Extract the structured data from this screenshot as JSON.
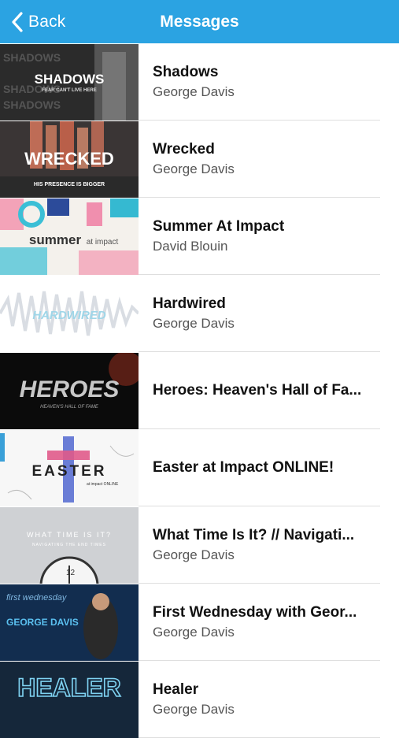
{
  "nav": {
    "back_label": "Back",
    "title": "Messages",
    "back_icon": "chevron-left-icon"
  },
  "messages": [
    {
      "title": "Shadows",
      "author": "George Davis",
      "thumb": {
        "text": "SHADOWS",
        "subtext": "FEAR CAN'T LIVE HERE"
      }
    },
    {
      "title": "Wrecked",
      "author": "George Davis",
      "thumb": {
        "text": "WRECKED",
        "subtext": "HIS PRESENCE IS BIGGER"
      }
    },
    {
      "title": "Summer At Impact",
      "author": "David Blouin",
      "thumb": {
        "text": "summer",
        "subtext": "at impact"
      }
    },
    {
      "title": "Hardwired",
      "author": "George Davis",
      "thumb": {
        "text": "HARDWIRED"
      }
    },
    {
      "title": "Heroes: Heaven's Hall of Fa...",
      "author": "",
      "thumb": {
        "text": "HEROES",
        "subtext": "HEAVEN'S HALL OF FAME"
      }
    },
    {
      "title": "Easter at Impact ONLINE!",
      "author": "",
      "thumb": {
        "text": "EASTER",
        "subtext": "at impact ONLINE"
      }
    },
    {
      "title": "What Time Is It? // Navigati...",
      "author": "George Davis",
      "thumb": {
        "text": "WHAT TIME IS IT?",
        "subtext": "NAVIGATING THE END TIMES"
      }
    },
    {
      "title": "First Wednesday with Geor...",
      "author": "George Davis",
      "thumb": {
        "text": "GEORGE DAVIS",
        "subtext": "first wednesday"
      }
    },
    {
      "title": "Healer",
      "author": "George Davis",
      "thumb": {
        "text": "HEALER"
      }
    }
  ]
}
